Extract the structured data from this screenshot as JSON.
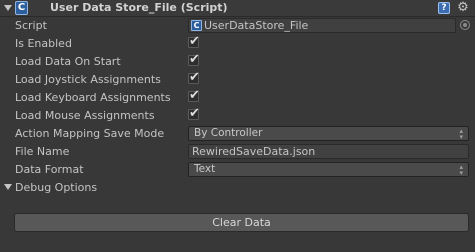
{
  "header": {
    "title": "User Data Store_File (Script)",
    "component_icon": "csharp-script-icon",
    "component_icon_glyph": "C",
    "help_icon_glyph": "?",
    "gear_icon_glyph": "⚙"
  },
  "fields": {
    "script": {
      "label": "Script",
      "value": "UserDataStore_File",
      "icon_glyph": "C"
    },
    "is_enabled": {
      "label": "Is Enabled",
      "checked": true
    },
    "load_data_on_start": {
      "label": "Load Data On Start",
      "checked": true
    },
    "load_joystick": {
      "label": "Load Joystick Assignments",
      "checked": true
    },
    "load_keyboard": {
      "label": "Load Keyboard Assignments",
      "checked": true
    },
    "load_mouse": {
      "label": "Load Mouse Assignments",
      "checked": true
    },
    "action_mapping_save_mode": {
      "label": "Action Mapping Save Mode",
      "value": "By Controller"
    },
    "file_name": {
      "label": "File Name",
      "value": "RewiredSaveData.json"
    },
    "data_format": {
      "label": "Data Format",
      "value": "Text"
    },
    "debug_options": {
      "label": "Debug Options",
      "expanded": true
    }
  },
  "check_glyph": "✔",
  "dropdown_arrow_glyph": "▲▼",
  "actions": {
    "clear_data_label": "Clear Data"
  },
  "colors": {
    "background": "#383838",
    "text": "#c4c4c4",
    "script_icon": "#2d5f9e"
  }
}
